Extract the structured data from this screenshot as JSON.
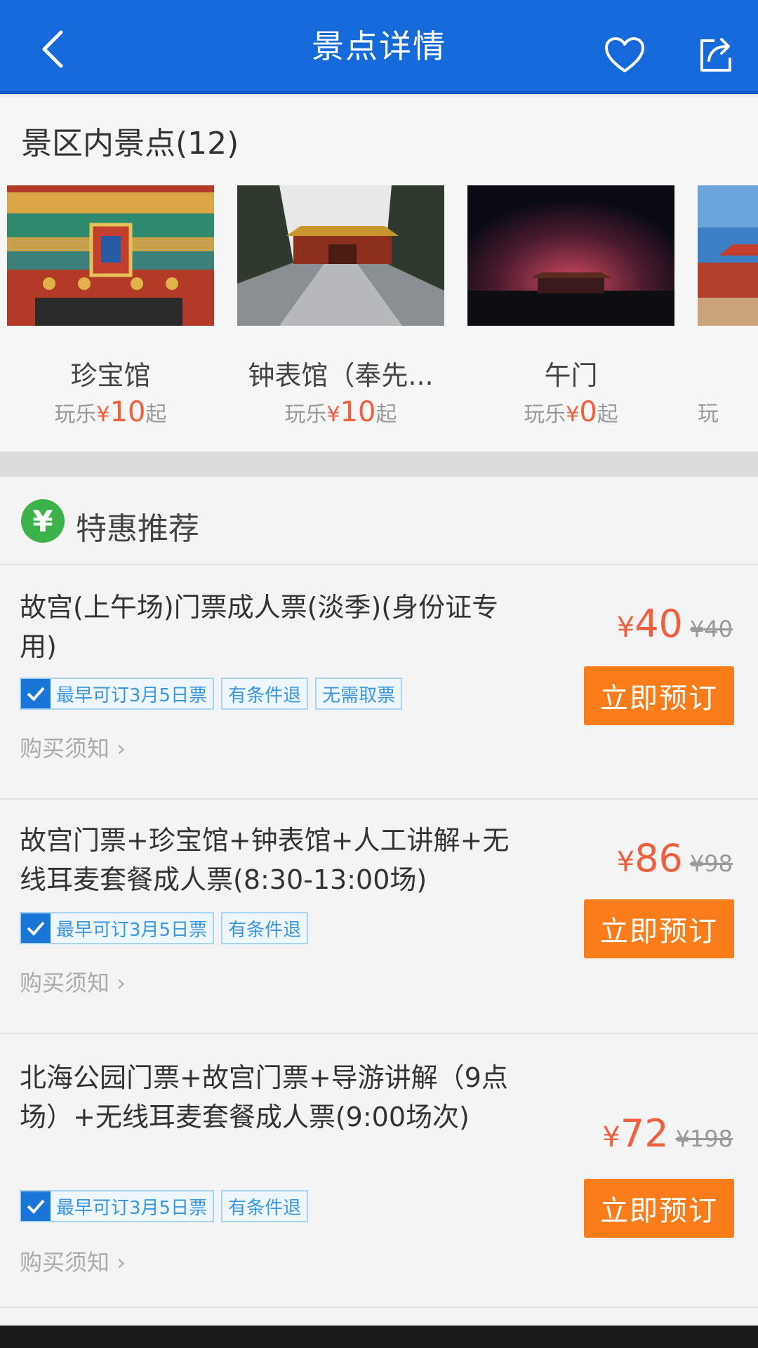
{
  "header": {
    "title": "景点详情"
  },
  "spots": {
    "title": "景区内景点(12)",
    "items": [
      {
        "name": "珍宝馆",
        "prefix": "玩乐",
        "currency": "¥",
        "price": "10",
        "suffix": "起"
      },
      {
        "name": "钟表馆（奉先...",
        "prefix": "玩乐",
        "currency": "¥",
        "price": "10",
        "suffix": "起"
      },
      {
        "name": "午门",
        "prefix": "玩乐",
        "currency": "¥",
        "price": "0",
        "suffix": "起"
      },
      {
        "name": "",
        "prefix": "玩",
        "currency": "",
        "price": "",
        "suffix": ""
      }
    ]
  },
  "deals": {
    "title": "特惠推荐",
    "badge_icon": "yen-icon",
    "notice_label": "购买须知",
    "book_label": "立即预订",
    "items": [
      {
        "name": "故宫(上午场)门票成人票(淡季)(身份证专用)",
        "tags": [
          "最早可订3月5日票",
          "有条件退",
          "无需取票"
        ],
        "currency": "¥",
        "price": "40",
        "old_price": "¥40"
      },
      {
        "name": "故宫门票+珍宝馆+钟表馆+人工讲解+无线耳麦套餐成人票(8:30-13:00场)",
        "tags": [
          "最早可订3月5日票",
          "有条件退"
        ],
        "currency": "¥",
        "price": "86",
        "old_price": "¥98"
      },
      {
        "name": "北海公园门票+故宫门票+导游讲解（9点场）+无线耳麦套餐成人票(9:00场次)",
        "tags": [
          "最早可订3月5日票",
          "有条件退"
        ],
        "currency": "¥",
        "price": "72",
        "old_price": "¥198"
      }
    ]
  },
  "colors": {
    "header": "#1569d8",
    "price": "#f0603e",
    "button": "#fb7c1a",
    "tag_text": "#3b96de",
    "badge": "#3bb34a"
  }
}
